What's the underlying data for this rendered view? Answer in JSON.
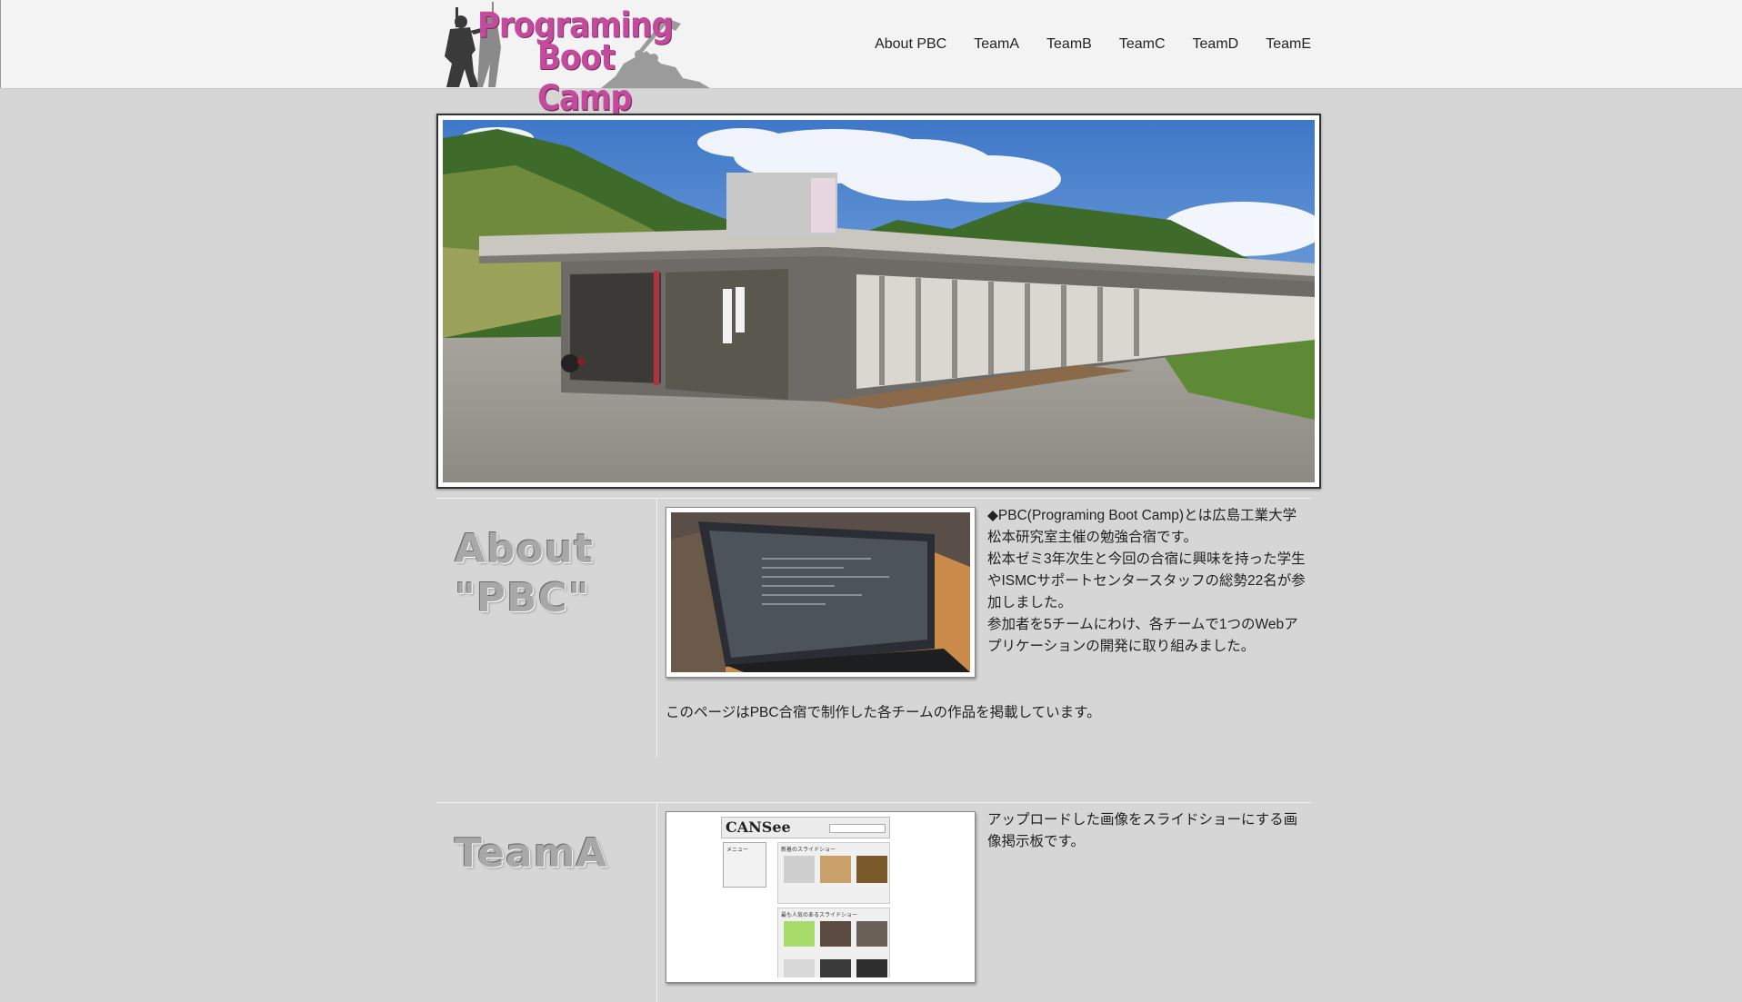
{
  "header": {
    "logo": {
      "line1": "Programing",
      "line2": "Boot Camp"
    },
    "nav": [
      "About PBC",
      "TeamA",
      "TeamB",
      "TeamC",
      "TeamD",
      "TeamE"
    ]
  },
  "about": {
    "heading_line1": "About",
    "heading_line2": "\"PBC\"",
    "description": "◆PBC(Programing Boot Camp)とは広島工業大学 松本研究室主催の勉強合宿です。\n松本ゼミ3年次生と今回の合宿に興味を持った学生やISMCサポートセンタースタッフの総勢22名が参加しました。\n参加者を5チームにわけ、各チームで1つのWebアプリケーションの開発に取り組みました。",
    "note": "このページはPBC合宿で制作した各チームの作品を掲載しています。"
  },
  "teamA": {
    "heading": "TeamA",
    "description": "アップロードした画像をスライドショーにする画像掲示板です。",
    "screenshot": {
      "app_name": "CANSee",
      "menu_title": "メニュー",
      "section1": "新着のスライドショー",
      "section2": "最も人気のあるスライドショー"
    }
  },
  "colors": {
    "accent": "#c44b9c",
    "background": "#d6d6d6",
    "header": "#f3f3f3"
  }
}
